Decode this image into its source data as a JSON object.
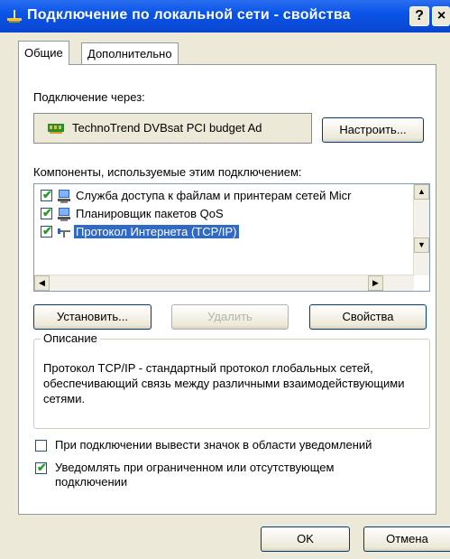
{
  "window": {
    "title": "Подключение по локальной сети - свойства",
    "help_button": "?",
    "close_button": "×"
  },
  "tabs": [
    {
      "label": "Общие",
      "active": true
    },
    {
      "label": "Дополнительно",
      "active": false
    }
  ],
  "connect_using": {
    "label": "Подключение через:",
    "adapter_name": "TechnoTrend DVBsat PCI budget Ad",
    "configure_button": "Настроить..."
  },
  "components": {
    "label": "Компоненты, используемые этим подключением:",
    "items": [
      {
        "label": "Служба доступа к файлам и принтерам сетей Micr",
        "checked": true,
        "selected": false,
        "icon": "file-printer-sharing-icon"
      },
      {
        "label": "Планировщик пакетов QoS",
        "checked": true,
        "selected": false,
        "icon": "qos-scheduler-icon"
      },
      {
        "label": "Протокол Интернета (TCP/IP)",
        "checked": true,
        "selected": true,
        "icon": "network-protocol-icon"
      }
    ]
  },
  "actions": {
    "install": "Установить...",
    "uninstall": "Удалить",
    "properties": "Свойства"
  },
  "description": {
    "title": "Описание",
    "text": "Протокол TCP/IP - стандартный протокол глобальных сетей, обеспечивающий связь между различными взаимодействующими сетями."
  },
  "options": [
    {
      "label": "При подключении вывести значок в области уведомлений",
      "checked": false
    },
    {
      "label": "Уведомлять при ограниченном или отсутствующем подключении",
      "checked": true
    }
  ],
  "footer": {
    "ok": "OK",
    "cancel": "Отмена"
  },
  "colors": {
    "titlebar": "#0A54E8",
    "selection": "#316AC5",
    "dialog_bg": "#ECE9D8",
    "check": "#21A121"
  }
}
